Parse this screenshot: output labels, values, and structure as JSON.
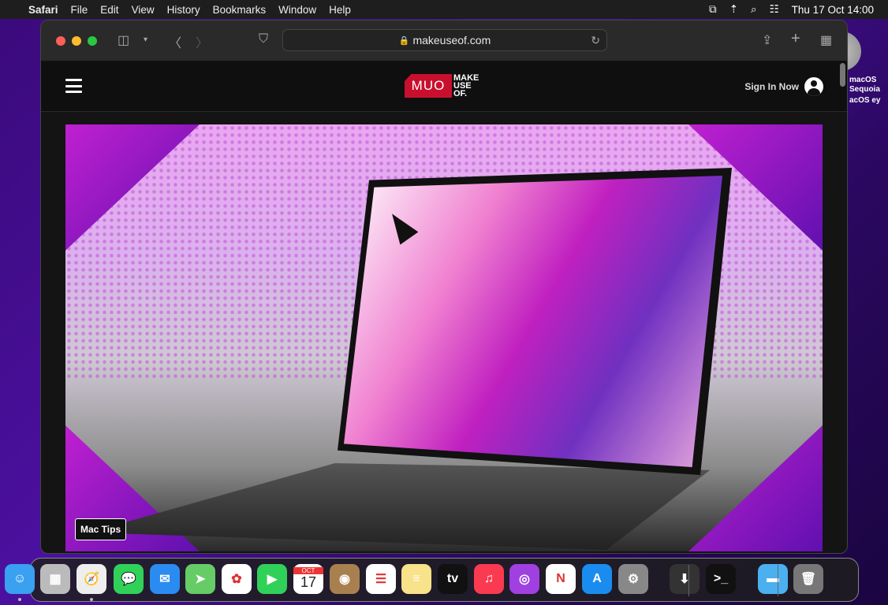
{
  "menubar": {
    "apple": "",
    "app": "Safari",
    "items": [
      "File",
      "Edit",
      "View",
      "History",
      "Bookmarks",
      "Window",
      "Help"
    ],
    "datetime": "Thu 17 Oct  14:00"
  },
  "desktop": {
    "label": "macOS\nSequoia",
    "label_visible": "acOS ey"
  },
  "browser": {
    "url": "makeuseof.com",
    "colors": {
      "close": "#ff5f57",
      "minimize": "#febc2e",
      "zoom": "#28c840"
    }
  },
  "site": {
    "logo_mark": "MUO",
    "logo_words": [
      "MAKE",
      "USE",
      "OF."
    ],
    "sign_in": "Sign In Now",
    "brand_color": "#c8102e"
  },
  "hero": {
    "tag": "Mac Tips"
  },
  "dock": {
    "apps": [
      {
        "name": "finder",
        "bg": "#3aa0f0",
        "glyph": "☺",
        "running": true
      },
      {
        "name": "launchpad",
        "bg": "#bbb",
        "glyph": "▦"
      },
      {
        "name": "safari",
        "bg": "#eee",
        "glyph": "🧭",
        "running": true
      },
      {
        "name": "messages",
        "bg": "#30d158",
        "glyph": "💬"
      },
      {
        "name": "mail",
        "bg": "#2a8cf0",
        "glyph": "✉"
      },
      {
        "name": "maps",
        "bg": "#6c6",
        "glyph": "➤"
      },
      {
        "name": "photos",
        "bg": "#fff",
        "glyph": "✿"
      },
      {
        "name": "facetime",
        "bg": "#30d158",
        "glyph": "▶"
      },
      {
        "name": "calendar",
        "bg": "#fff",
        "glyph": "17",
        "month": "OCT"
      },
      {
        "name": "contacts",
        "bg": "#a8804f",
        "glyph": "◉"
      },
      {
        "name": "reminders",
        "bg": "#fff",
        "glyph": "☰"
      },
      {
        "name": "notes",
        "bg": "#f8e28a",
        "glyph": "≡"
      },
      {
        "name": "tv",
        "bg": "#111",
        "glyph": "tv"
      },
      {
        "name": "music",
        "bg": "#fa3a50",
        "glyph": "♫"
      },
      {
        "name": "podcasts",
        "bg": "#a040e0",
        "glyph": "◎"
      },
      {
        "name": "news",
        "bg": "#fff",
        "glyph": "N"
      },
      {
        "name": "app-store",
        "bg": "#1a8cf0",
        "glyph": "A"
      },
      {
        "name": "system-settings",
        "bg": "#888",
        "glyph": "⚙"
      },
      {
        "name": "macos-installer",
        "bg": "#333",
        "glyph": "⬇"
      },
      {
        "name": "terminal",
        "bg": "#111",
        "glyph": ">_"
      },
      {
        "name": "downloads-folder",
        "bg": "#4ab0f0",
        "glyph": "▬"
      },
      {
        "name": "trash",
        "bg": "#777",
        "glyph": "🗑"
      }
    ]
  }
}
